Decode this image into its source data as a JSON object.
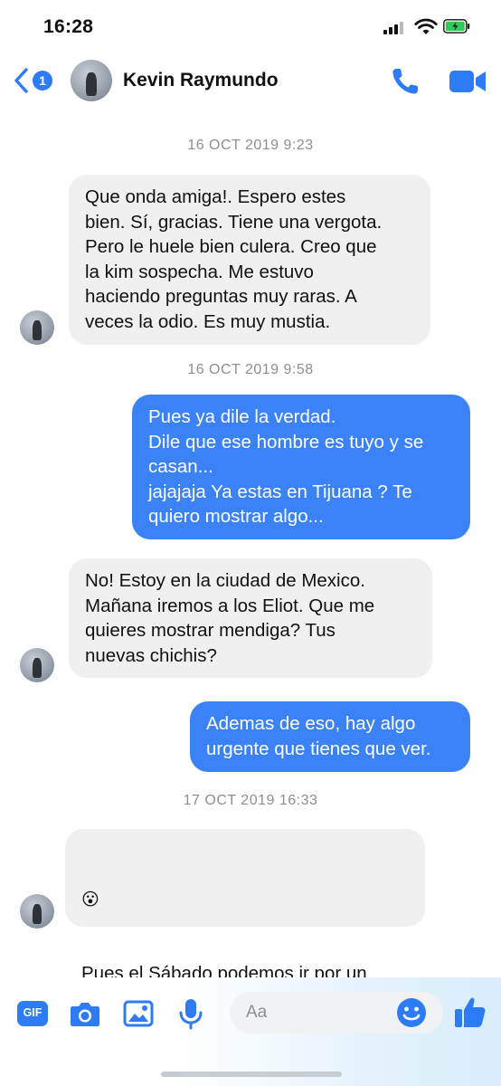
{
  "status_bar": {
    "time": "16:28"
  },
  "header": {
    "unread_count": "1",
    "contact_name": "Kevin Raymundo",
    "icons": [
      "back-icon",
      "phone-icon",
      "video-camera-icon"
    ]
  },
  "conversation": {
    "timestamps": [
      "16 OCT 2019 9:23",
      "16 OCT 2019 9:58",
      "17 OCT 2019 16:33"
    ],
    "messages": [
      {
        "direction": "incoming",
        "text": "Que onda amiga!. Espero estes\nbien. Sí, gracias. Tiene una vergota.\nPero le huele bien culera. Creo que\nla kim sospecha. Me estuvo\nhaciendo preguntas muy raras. A\nveces la odio. Es muy mustia."
      },
      {
        "direction": "outgoing",
        "text": "Pues ya dile la verdad.\nDile que ese hombre es tuyo y se\ncasan...\njajajaja Ya estas en Tijuana ? Te\nquiero mostrar algo..."
      },
      {
        "direction": "incoming",
        "text": "No! Estoy en la ciudad de Mexico.\nMañana iremos a los Eliot. Que me\nquieres mostrar mendiga? Tus\nnuevas chichis?"
      },
      {
        "direction": "outgoing",
        "text": "Ademas de eso, hay algo\nurgente que tienes que ver."
      },
      {
        "direction": "incoming",
        "emoji": "😮",
        "text": "Pues el Sábado podemos ir por un\nCoffee"
      }
    ]
  },
  "composer": {
    "gif_label": "GIF",
    "placeholder": "Aa",
    "icons": [
      "gif-icon",
      "camera-icon",
      "image-icon",
      "microphone-icon",
      "emoji-icon",
      "thumbs-up-icon"
    ]
  },
  "colors": {
    "accent": "#2d7cf6",
    "outgoing_bubble": "#3b82f6",
    "incoming_bubble": "#f0f0f0",
    "timestamp": "#8e8e93"
  }
}
